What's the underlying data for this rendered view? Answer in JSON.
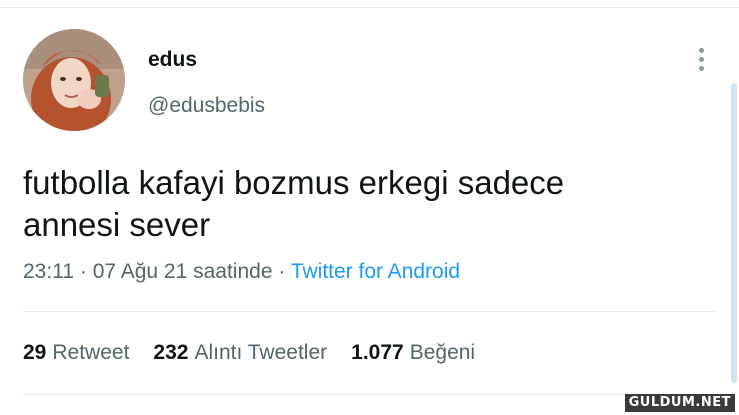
{
  "tweet": {
    "display_name": "edus",
    "handle": "@edusbebis",
    "text": "futbolla kafayi bozmus erkegi sadece annesi sever",
    "time": "23:11",
    "separator": "·",
    "date": "07 Ağu 21 saatinde",
    "source": "Twitter for Android"
  },
  "stats": {
    "retweets_count": "29",
    "retweets_label": "Retweet",
    "quotes_count": "232",
    "quotes_label": "Alıntı Tweetler",
    "likes_count": "1.077",
    "likes_label": "Beğeni"
  },
  "watermark": "GULDUM.NET",
  "colors": {
    "link": "#1d9bf0",
    "secondary_text": "#536471",
    "primary_text": "#0f1419"
  },
  "icons": {
    "more": "more-vertical-icon",
    "avatar": "avatar"
  }
}
